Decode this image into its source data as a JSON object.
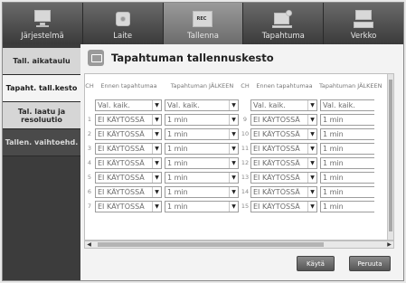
{
  "topnav": {
    "tabs": [
      {
        "label": "Järjestelmä",
        "icon": "monitor-icon"
      },
      {
        "label": "Laite",
        "icon": "camera-icon"
      },
      {
        "label": "Tallenna",
        "icon": "rec-icon",
        "badge": "REC"
      },
      {
        "label": "Tapahtuma",
        "icon": "event-icon"
      },
      {
        "label": "Verkko",
        "icon": "network-icon"
      }
    ]
  },
  "sidebar": {
    "items": [
      {
        "label": "Tall. aikataulu"
      },
      {
        "label": "Tapaht. tall.kesto"
      },
      {
        "label": "Tal. laatu ja resoluutio"
      },
      {
        "label": "Tallen. vaihtoehd."
      }
    ]
  },
  "main": {
    "title": "Tapahtuman tallennuskesto"
  },
  "table": {
    "headers": {
      "ch": "CH",
      "before": "Ennen tapahtumaa",
      "after": "Tapahtuman JÄLKEEN"
    },
    "all_row": {
      "before": "Val. kaik.",
      "after": "Val. kaik.",
      "before2": "Val. kaik.",
      "after2": "Val. kaik."
    },
    "rows": [
      {
        "ch1": "1",
        "b1": "EI KÄYTÖSSÄ",
        "a1": "1 min",
        "ch2": "9",
        "b2": "EI KÄYTÖSSÄ",
        "a2": "1 min"
      },
      {
        "ch1": "2",
        "b1": "EI KÄYTÖSSÄ",
        "a1": "1 min",
        "ch2": "10",
        "b2": "EI KÄYTÖSSÄ",
        "a2": "1 min"
      },
      {
        "ch1": "3",
        "b1": "EI KÄYTÖSSÄ",
        "a1": "1 min",
        "ch2": "11",
        "b2": "EI KÄYTÖSSÄ",
        "a2": "1 min"
      },
      {
        "ch1": "4",
        "b1": "EI KÄYTÖSSÄ",
        "a1": "1 min",
        "ch2": "12",
        "b2": "EI KÄYTÖSSÄ",
        "a2": "1 min"
      },
      {
        "ch1": "5",
        "b1": "EI KÄYTÖSSÄ",
        "a1": "1 min",
        "ch2": "13",
        "b2": "EI KÄYTÖSSÄ",
        "a2": "1 min"
      },
      {
        "ch1": "6",
        "b1": "EI KÄYTÖSSÄ",
        "a1": "1 min",
        "ch2": "14",
        "b2": "EI KÄYTÖSSÄ",
        "a2": "1 min"
      },
      {
        "ch1": "7",
        "b1": "EI KÄYTÖSSÄ",
        "a1": "1 min",
        "ch2": "15",
        "b2": "EI KÄYTÖSSÄ",
        "a2": "1 min"
      }
    ]
  },
  "buttons": {
    "apply": "Käytä",
    "cancel": "Peruuta"
  }
}
